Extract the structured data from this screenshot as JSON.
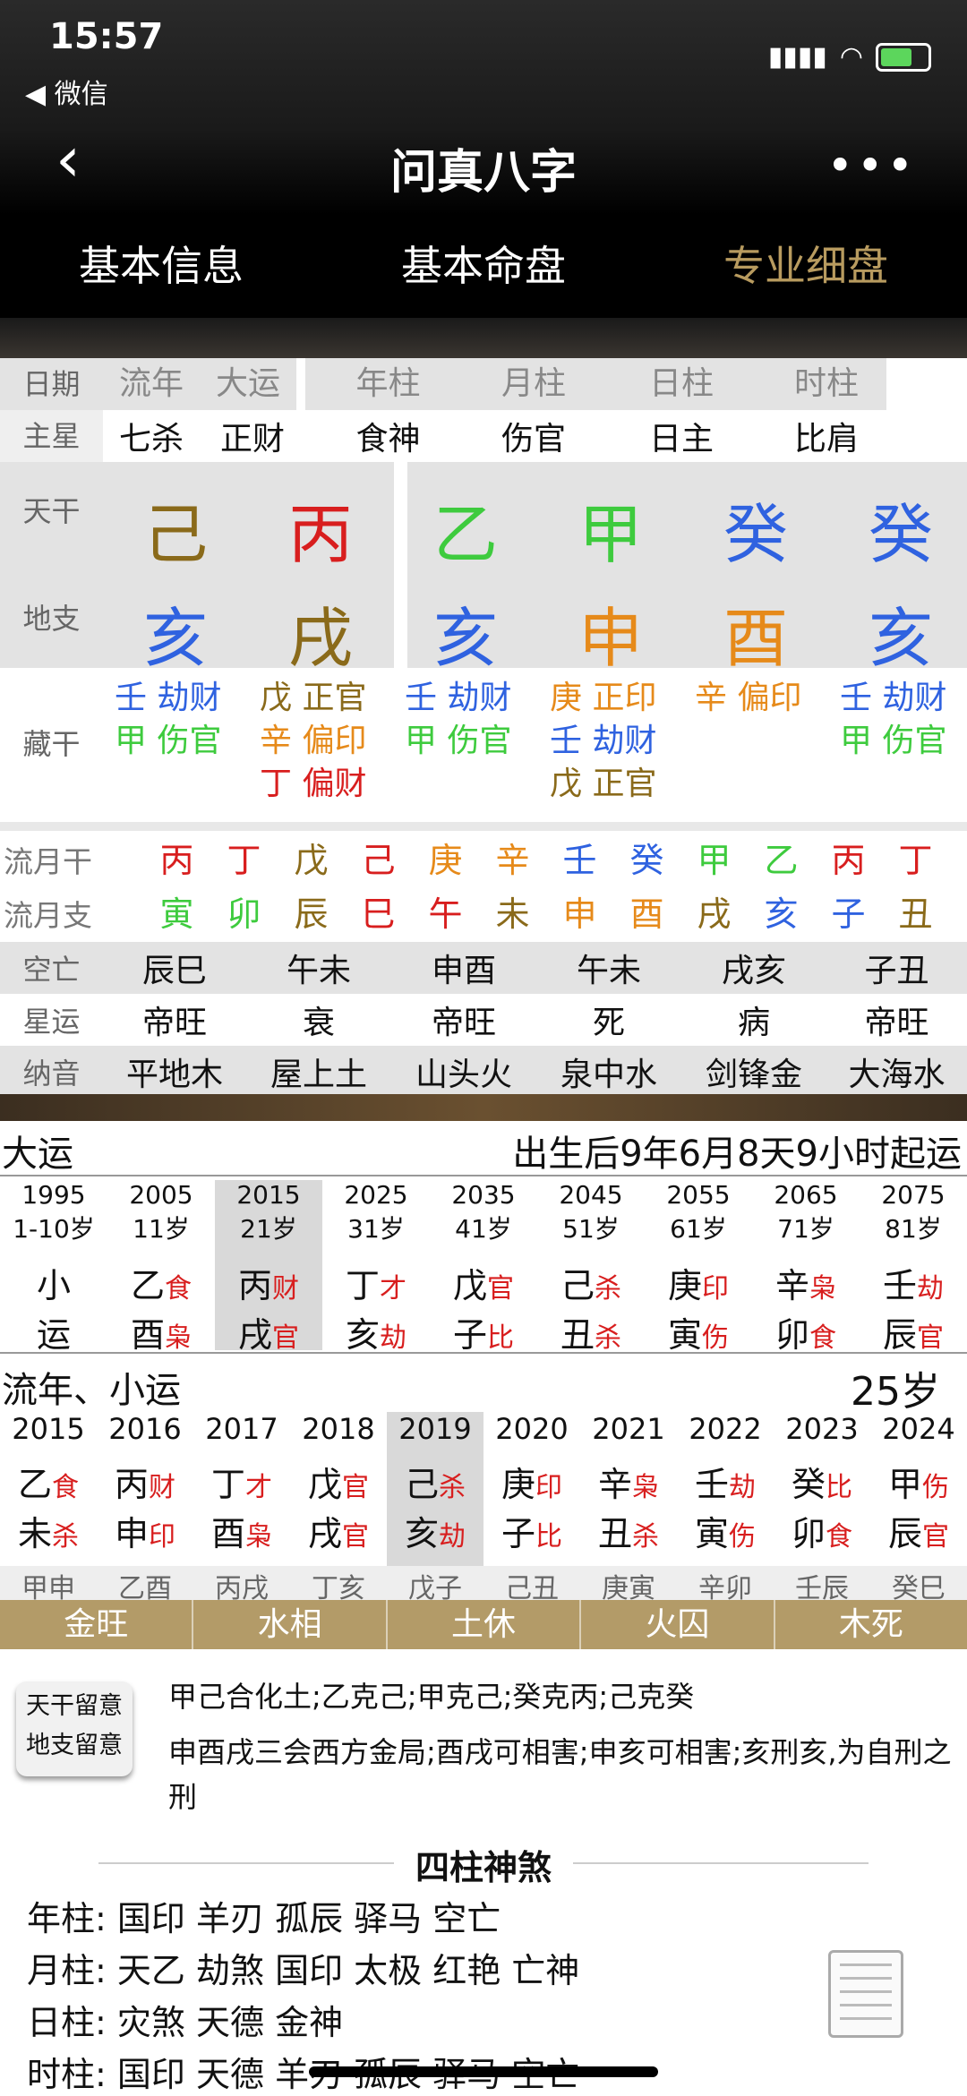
{
  "status": {
    "time": "15:57",
    "back_app": "◀ 微信"
  },
  "nav": {
    "title": "问真八字",
    "back": "‹",
    "more": "•••"
  },
  "tabs": [
    "基本信息",
    "基本命盘",
    "专业细盘"
  ],
  "header_row": [
    "日期",
    "流年",
    "大运",
    "年柱",
    "月柱",
    "日柱",
    "时柱"
  ],
  "zhuxing": {
    "label": "主星",
    "values": [
      "七杀",
      "正财",
      "食神",
      "伤官",
      "日主",
      "比肩"
    ]
  },
  "tiangan": {
    "label": "天干",
    "values": [
      "己",
      "丙",
      "乙",
      "甲",
      "癸",
      "癸"
    ]
  },
  "dizhi": {
    "label": "地支",
    "values": [
      "亥",
      "戌",
      "亥",
      "申",
      "酉",
      "亥"
    ]
  },
  "canggan": {
    "label": "藏干",
    "cols": [
      [
        "壬 劫财",
        "甲 伤官"
      ],
      [
        "戊 正官",
        "辛 偏印",
        "丁 偏财"
      ],
      [
        "壬 劫财",
        "甲 伤官"
      ],
      [
        "庚 正印",
        "壬 劫财",
        "戊 正官"
      ],
      [
        "辛 偏印"
      ],
      [
        "壬 劫财",
        "甲 伤官"
      ]
    ]
  },
  "liuyuegan": {
    "label": "流月干",
    "values": [
      "丙",
      "丁",
      "戊",
      "己",
      "庚",
      "辛",
      "壬",
      "癸",
      "甲",
      "乙",
      "丙",
      "丁"
    ]
  },
  "liuyuezhi": {
    "label": "流月支",
    "values": [
      "寅",
      "卯",
      "辰",
      "巳",
      "午",
      "未",
      "申",
      "酉",
      "戌",
      "亥",
      "子",
      "丑"
    ]
  },
  "kongwang": {
    "label": "空亡",
    "values": [
      "辰巳",
      "午未",
      "申酉",
      "午未",
      "戌亥",
      "子丑"
    ]
  },
  "xingyun": {
    "label": "星运",
    "values": [
      "帝旺",
      "衰",
      "帝旺",
      "死",
      "病",
      "帝旺"
    ]
  },
  "nayin": {
    "label": "纳音",
    "values": [
      "平地木",
      "屋上土",
      "山头火",
      "泉中水",
      "剑锋金",
      "大海水"
    ]
  },
  "dayun": {
    "title": "大运",
    "start": "出生后9年6月8天9小时起运",
    "cols": [
      {
        "year": "1995",
        "age": "1-10岁",
        "g": "小",
        "gs": "",
        "z": "运",
        "zs": ""
      },
      {
        "year": "2005",
        "age": "11岁",
        "g": "乙",
        "gs": "食",
        "z": "酉",
        "zs": "枭"
      },
      {
        "year": "2015",
        "age": "21岁",
        "g": "丙",
        "gs": "财",
        "z": "戌",
        "zs": "官"
      },
      {
        "year": "2025",
        "age": "31岁",
        "g": "丁",
        "gs": "才",
        "z": "亥",
        "zs": "劫"
      },
      {
        "year": "2035",
        "age": "41岁",
        "g": "戊",
        "gs": "官",
        "z": "子",
        "zs": "比"
      },
      {
        "year": "2045",
        "age": "51岁",
        "g": "己",
        "gs": "杀",
        "z": "丑",
        "zs": "杀"
      },
      {
        "year": "2055",
        "age": "61岁",
        "g": "庚",
        "gs": "印",
        "z": "寅",
        "zs": "伤"
      },
      {
        "year": "2065",
        "age": "71岁",
        "g": "辛",
        "gs": "枭",
        "z": "卯",
        "zs": "食"
      },
      {
        "year": "2075",
        "age": "81岁",
        "g": "壬",
        "gs": "劫",
        "z": "辰",
        "zs": "官"
      }
    ]
  },
  "liunian": {
    "title": "流年、小运",
    "age": "25岁",
    "cols": [
      {
        "year": "2015",
        "g": "乙",
        "gs": "食",
        "z": "未",
        "zs": "杀",
        "xy": "甲申"
      },
      {
        "year": "2016",
        "g": "丙",
        "gs": "财",
        "z": "申",
        "zs": "印",
        "xy": "乙酉"
      },
      {
        "year": "2017",
        "g": "丁",
        "gs": "才",
        "z": "酉",
        "zs": "枭",
        "xy": "丙戌"
      },
      {
        "year": "2018",
        "g": "戊",
        "gs": "官",
        "z": "戌",
        "zs": "官",
        "xy": "丁亥"
      },
      {
        "year": "2019",
        "g": "己",
        "gs": "杀",
        "z": "亥",
        "zs": "劫",
        "xy": "戊子"
      },
      {
        "year": "2020",
        "g": "庚",
        "gs": "印",
        "z": "子",
        "zs": "比",
        "xy": "己丑"
      },
      {
        "year": "2021",
        "g": "辛",
        "gs": "枭",
        "z": "丑",
        "zs": "杀",
        "xy": "庚寅"
      },
      {
        "year": "2022",
        "g": "壬",
        "gs": "劫",
        "z": "寅",
        "zs": "伤",
        "xy": "辛卯"
      },
      {
        "year": "2023",
        "g": "癸",
        "gs": "比",
        "z": "卯",
        "zs": "食",
        "xy": "壬辰"
      },
      {
        "year": "2024",
        "g": "甲",
        "gs": "伤",
        "z": "辰",
        "zs": "官",
        "xy": "癸巳"
      }
    ]
  },
  "wuxing": [
    "金旺",
    "水相",
    "土休",
    "火囚",
    "木死"
  ],
  "notes": {
    "button": [
      "天干留意",
      "地支留意"
    ],
    "tiangan": "甲己合化土;乙克己;甲克己;癸克丙;己克癸",
    "dizhi": "申酉戌三会西方金局;酉戌可相害;申亥可相害;亥刑亥,为自刑之刑"
  },
  "shensha": {
    "title": "四柱神煞",
    "rows": [
      {
        "label": "年柱:",
        "items": "国印 羊刃 孤辰 驿马 空亡"
      },
      {
        "label": "月柱:",
        "items": "天乙 劫煞 国印 太极 红艳 亡神"
      },
      {
        "label": "日柱:",
        "items": "灾煞 天德 金神"
      },
      {
        "label": "时柱:",
        "items": "国印 天德 羊刃 孤辰 驿马 空亡"
      }
    ]
  },
  "colors": {
    "accent": "#b89b5f",
    "red": "#d81e1e",
    "green": "#3ecb3e",
    "blue": "#2f62e0",
    "brown": "#8a6a1a",
    "orange": "#e68a1a"
  }
}
